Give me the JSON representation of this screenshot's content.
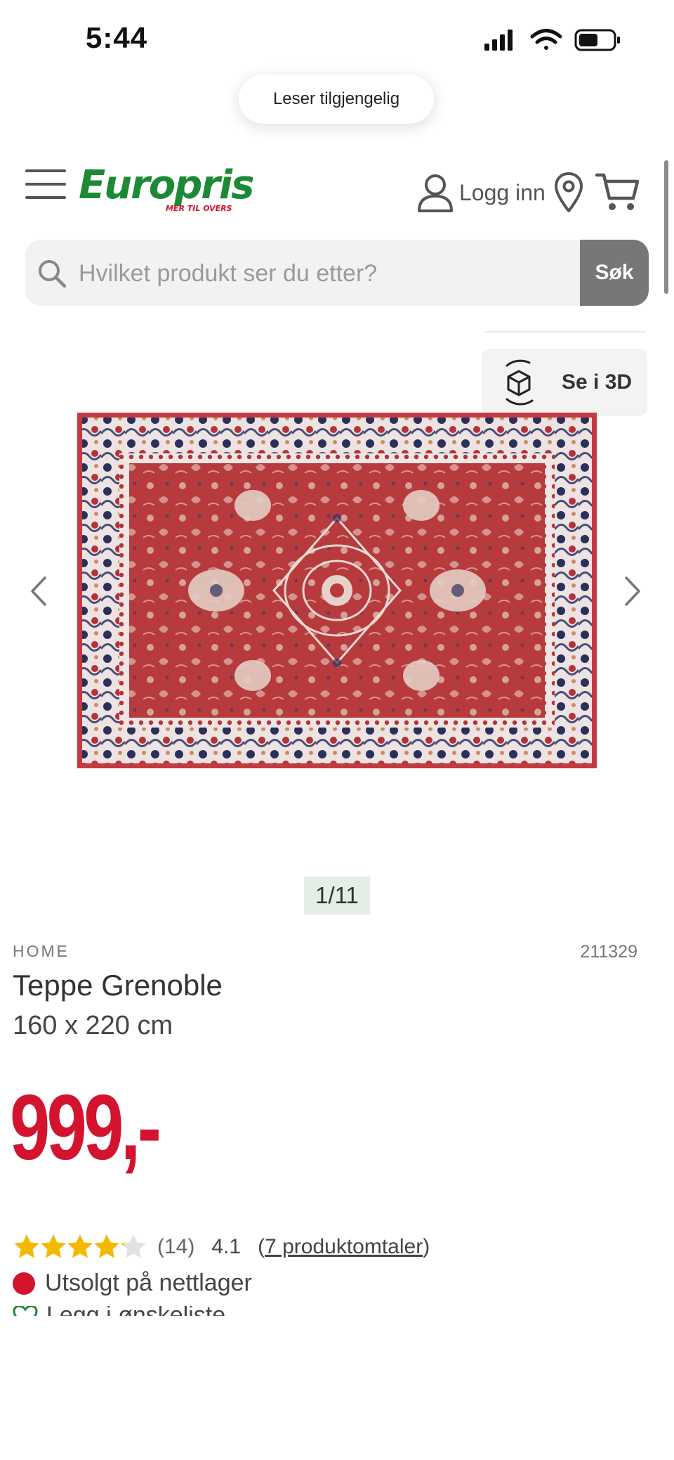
{
  "status_bar": {
    "time": "5:44"
  },
  "reader": {
    "label": "Leser tilgjengelig"
  },
  "header": {
    "logo_text": "Europris",
    "logo_tagline": "MER TIL OVERS",
    "login_label": "Logg inn"
  },
  "search": {
    "placeholder": "Hvilket produkt ser du etter?",
    "button_label": "Søk"
  },
  "view_3d": {
    "label": "Se i 3D"
  },
  "gallery": {
    "counter": "1/11"
  },
  "product": {
    "brand": "HOME",
    "sku": "211329",
    "title": "Teppe Grenoble",
    "size": "160 x 220 cm",
    "price": "999,-",
    "rating_count": "(14)",
    "rating_value": "4.1",
    "rating_fraction": 0.82,
    "reviews_open": "(",
    "reviews_link": "7 produktomtaler",
    "reviews_close": ")",
    "stock_status": "Utsolgt på nettlager",
    "wishlist_label": "Legg i ønskeliste"
  },
  "colors": {
    "brand_green": "#1c8a35",
    "price_red": "#d4142e",
    "star_yellow": "#f5b800",
    "search_button": "#777777"
  }
}
